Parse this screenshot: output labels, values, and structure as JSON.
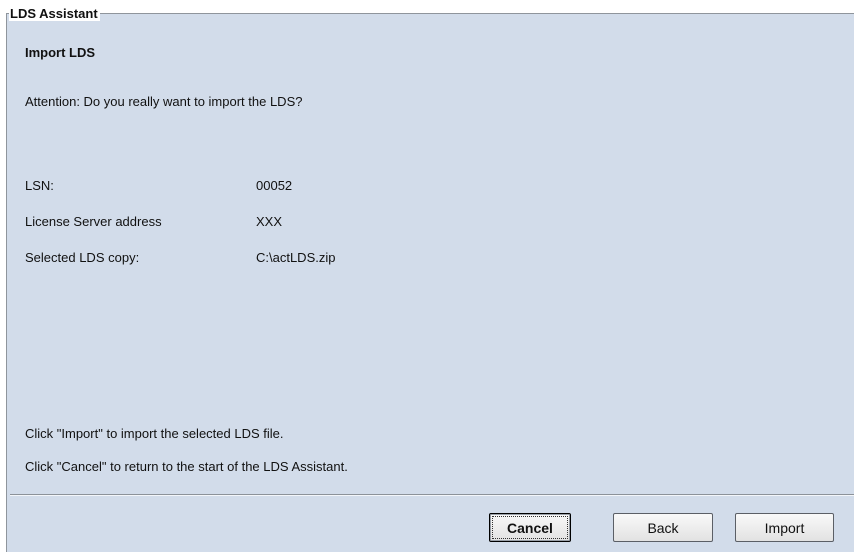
{
  "dialog": {
    "group_title": "LDS Assistant",
    "heading": "Import LDS",
    "attention": "Attention: Do you really want to import the LDS?"
  },
  "fields": [
    {
      "label": "LSN:",
      "value": "00052"
    },
    {
      "label": "License Server address",
      "value": "XXX"
    },
    {
      "label": "Selected LDS copy:",
      "value": "C:\\actLDS.zip"
    }
  ],
  "instructions": {
    "import_hint": "Click \"Import\" to import the selected LDS file.",
    "cancel_hint": "Click \"Cancel\" to return to the start of the LDS Assistant."
  },
  "buttons": {
    "cancel": "Cancel",
    "back": "Back",
    "import": "Import"
  }
}
